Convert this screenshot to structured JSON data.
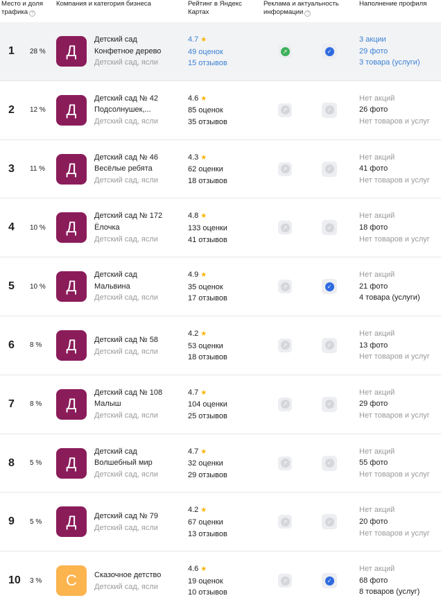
{
  "header": {
    "place": "Место и доля трафика",
    "company": "Компания и категория бизнеса",
    "rating": "Рейтинг в Яндекс Картах",
    "ads": "Реклама и актуальность информации",
    "profile": "Наполнение профиля",
    "help_icon": "?"
  },
  "colors": {
    "avatar_purple": "#8b1c5a",
    "avatar_orange": "#fbb44e",
    "link_blue": "#3b82d4",
    "highlight_row": "#f2f3f5"
  },
  "rows": [
    {
      "place": "1",
      "share": "28 %",
      "avatar": "Д",
      "avatar_color": "#8b1c5a",
      "name1": "Детский сад",
      "name2": "Конфетное дерево",
      "category": "Детский сад, ясли",
      "rating": "4.7",
      "ratings": "49 оценок",
      "reviews": "15 отзывов",
      "ads_on": true,
      "actual_on": true,
      "promos": "3 акции",
      "photos": "29 фото",
      "goods": "3 товара (услуги)",
      "highlight": true
    },
    {
      "place": "2",
      "share": "12 %",
      "avatar": "Д",
      "avatar_color": "#8b1c5a",
      "name1": "Детский сад № 42",
      "name2": "Подсолнушек,...",
      "category": "Детский сад, ясли",
      "rating": "4.6",
      "ratings": "85 оценок",
      "reviews": "35 отзывов",
      "ads_on": false,
      "actual_on": false,
      "promos": "Нет акций",
      "photos": "26 фото",
      "goods": "Нет товаров и услуг"
    },
    {
      "place": "3",
      "share": "11 %",
      "avatar": "Д",
      "avatar_color": "#8b1c5a",
      "name1": "Детский сад № 46",
      "name2": "Весёлые ребята",
      "category": "Детский сад, ясли",
      "rating": "4.3",
      "ratings": "62 оценки",
      "reviews": "18 отзывов",
      "ads_on": false,
      "actual_on": false,
      "promos": "Нет акций",
      "photos": "41 фото",
      "goods": "Нет товаров и услуг"
    },
    {
      "place": "4",
      "share": "10 %",
      "avatar": "Д",
      "avatar_color": "#8b1c5a",
      "name1": "Детский сад № 172",
      "name2": "Ёлочка",
      "category": "Детский сад, ясли",
      "rating": "4.8",
      "ratings": "133 оценки",
      "reviews": "41 отзывов",
      "ads_on": false,
      "actual_on": false,
      "promos": "Нет акций",
      "photos": "18 фото",
      "goods": "Нет товаров и услуг"
    },
    {
      "place": "5",
      "share": "10 %",
      "avatar": "Д",
      "avatar_color": "#8b1c5a",
      "name1": "Детский сад",
      "name2": "Мальвина",
      "category": "Детский сад, ясли",
      "rating": "4.9",
      "ratings": "35 оценок",
      "reviews": "17 отзывов",
      "ads_on": false,
      "actual_on": true,
      "promos": "Нет акций",
      "photos": "21 фото",
      "goods": "4 товара (услуги)"
    },
    {
      "place": "6",
      "share": "8 %",
      "avatar": "Д",
      "avatar_color": "#8b1c5a",
      "name1": "Детский сад № 58",
      "name2": "",
      "category": "Детский сад, ясли",
      "rating": "4.2",
      "ratings": "53 оценки",
      "reviews": "18 отзывов",
      "ads_on": false,
      "actual_on": false,
      "promos": "Нет акций",
      "photos": "13 фото",
      "goods": "Нет товаров и услуг"
    },
    {
      "place": "7",
      "share": "8 %",
      "avatar": "Д",
      "avatar_color": "#8b1c5a",
      "name1": "Детский сад № 108",
      "name2": "Малыш",
      "category": "Детский сад, ясли",
      "rating": "4.7",
      "ratings": "104 оценки",
      "reviews": "25 отзывов",
      "ads_on": false,
      "actual_on": false,
      "promos": "Нет акций",
      "photos": "29 фото",
      "goods": "Нет товаров и услуг"
    },
    {
      "place": "8",
      "share": "5 %",
      "avatar": "Д",
      "avatar_color": "#8b1c5a",
      "name1": "Детский сад",
      "name2": "Волшебный мир",
      "category": "Детский сад, ясли",
      "rating": "4.7",
      "ratings": "32 оценки",
      "reviews": "29 отзывов",
      "ads_on": false,
      "actual_on": false,
      "promos": "Нет акций",
      "photos": "55 фото",
      "goods": "Нет товаров и услуг"
    },
    {
      "place": "9",
      "share": "5 %",
      "avatar": "Д",
      "avatar_color": "#8b1c5a",
      "name1": "Детский сад № 79",
      "name2": "",
      "category": "Детский сад, ясли",
      "rating": "4.2",
      "ratings": "67 оценки",
      "reviews": "13 отзывов",
      "ads_on": false,
      "actual_on": false,
      "promos": "Нет акций",
      "photos": "20 фото",
      "goods": "Нет товаров и услуг"
    },
    {
      "place": "10",
      "share": "3 %",
      "avatar": "С",
      "avatar_color": "#fbb44e",
      "name1": "Сказочное детство",
      "name2": "",
      "category": "Детский сад, ясли",
      "rating": "4.6",
      "ratings": "19 оценок",
      "reviews": "10 отзывов",
      "ads_on": false,
      "actual_on": true,
      "promos": "Нет акций",
      "photos": "68 фото",
      "goods": "8 товаров (услуг)"
    }
  ]
}
